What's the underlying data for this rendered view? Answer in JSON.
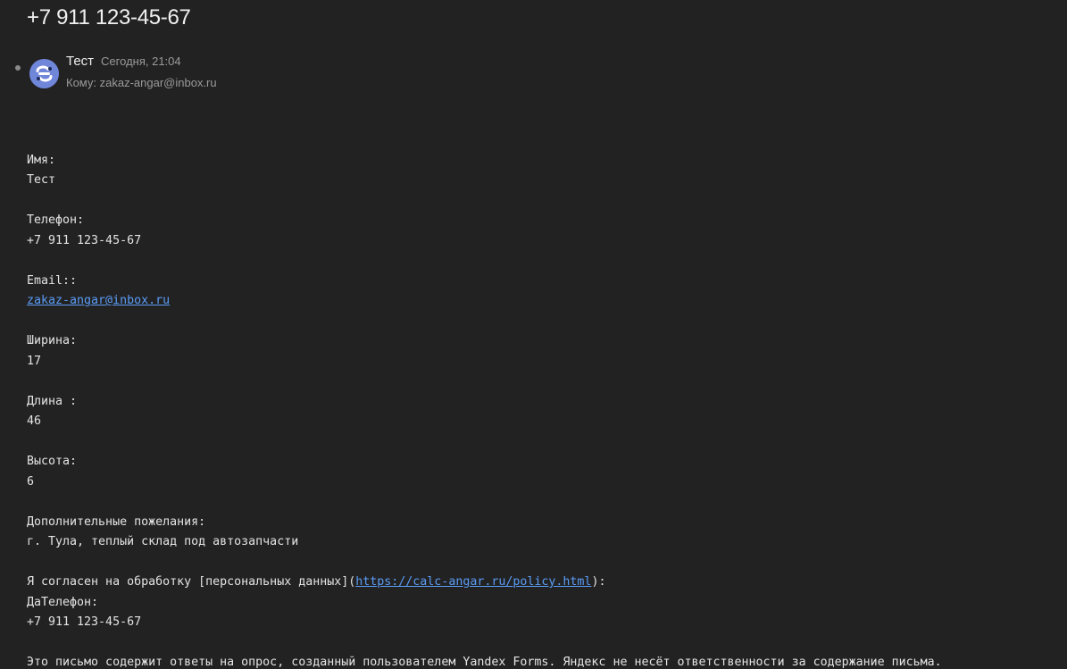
{
  "message": {
    "subject": "+7 911 123-45-67",
    "sender_name": "Тест",
    "time": "Сегодня, 21:04",
    "to_label": "Кому:",
    "to_address": "zakaz-angar@inbox.ru"
  },
  "body": {
    "name_label": "Имя:",
    "name_value": "Тест",
    "phone_label": "Телефон:",
    "phone_value": "+7 911 123-45-67",
    "email_label": "Email::",
    "email_value": "zakaz-angar@inbox.ru",
    "width_label": "Ширина:",
    "width_value": "17",
    "length_label": "Длина :",
    "length_value": "46",
    "height_label": "Высота:",
    "height_value": "6",
    "wishes_label": "Дополнительные пожелания:",
    "wishes_value": "г. Тула, теплый склад под автозапчасти",
    "consent_prefix": "Я согласен на обработку [персональных данных](",
    "consent_link": "https://calc-angar.ru/policy.html",
    "consent_suffix": "):",
    "consent_value_phone_label": "ДаТелефон:",
    "consent_value_phone": "+7 911 123-45-67",
    "footer": "Это письмо содержит ответы на опрос, созданный пользователем Yandex Forms. Яндекс не несёт ответственности за содержание письма."
  },
  "colors": {
    "background": "#222223",
    "link": "#5b9cf5",
    "avatar": "#6f86d9"
  },
  "icons": {
    "avatar": "yandex-forms-avatar-icon",
    "unread": "unread-dot-icon"
  }
}
